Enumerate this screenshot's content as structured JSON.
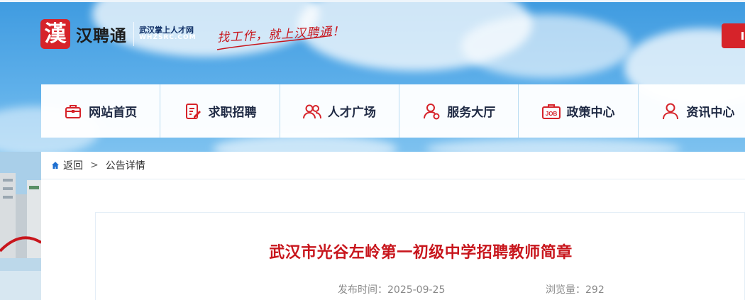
{
  "header": {
    "logo_char": "漢",
    "logo_name": "汉聘通",
    "logo_sub_cn": "武汉掌上人才网",
    "logo_sub_en": "WHZSRC.COM",
    "slogan": "找工作，就上汉聘通！"
  },
  "nav": {
    "items": [
      {
        "label": "网站首页",
        "icon": "briefcase-icon"
      },
      {
        "label": "求职招聘",
        "icon": "resume-edit-icon"
      },
      {
        "label": "人才广场",
        "icon": "people-icon"
      },
      {
        "label": "服务大厅",
        "icon": "service-user-icon"
      },
      {
        "label": "政策中心",
        "icon": "job-bag-icon"
      },
      {
        "label": "资讯中心",
        "icon": "user-icon"
      }
    ]
  },
  "breadcrumb": {
    "back": "返回",
    "separator": ">",
    "current": "公告详情"
  },
  "article": {
    "title": "武汉市光谷左岭第一初级中学招聘教师简章",
    "publish_label": "发布时间：2025-09-25",
    "views_label": "浏览量：292"
  },
  "colors": {
    "brand_red": "#d6232a",
    "title_red": "#c8161d",
    "nav_text": "#1f2a44",
    "sky_blue": "#5fb0ea"
  }
}
